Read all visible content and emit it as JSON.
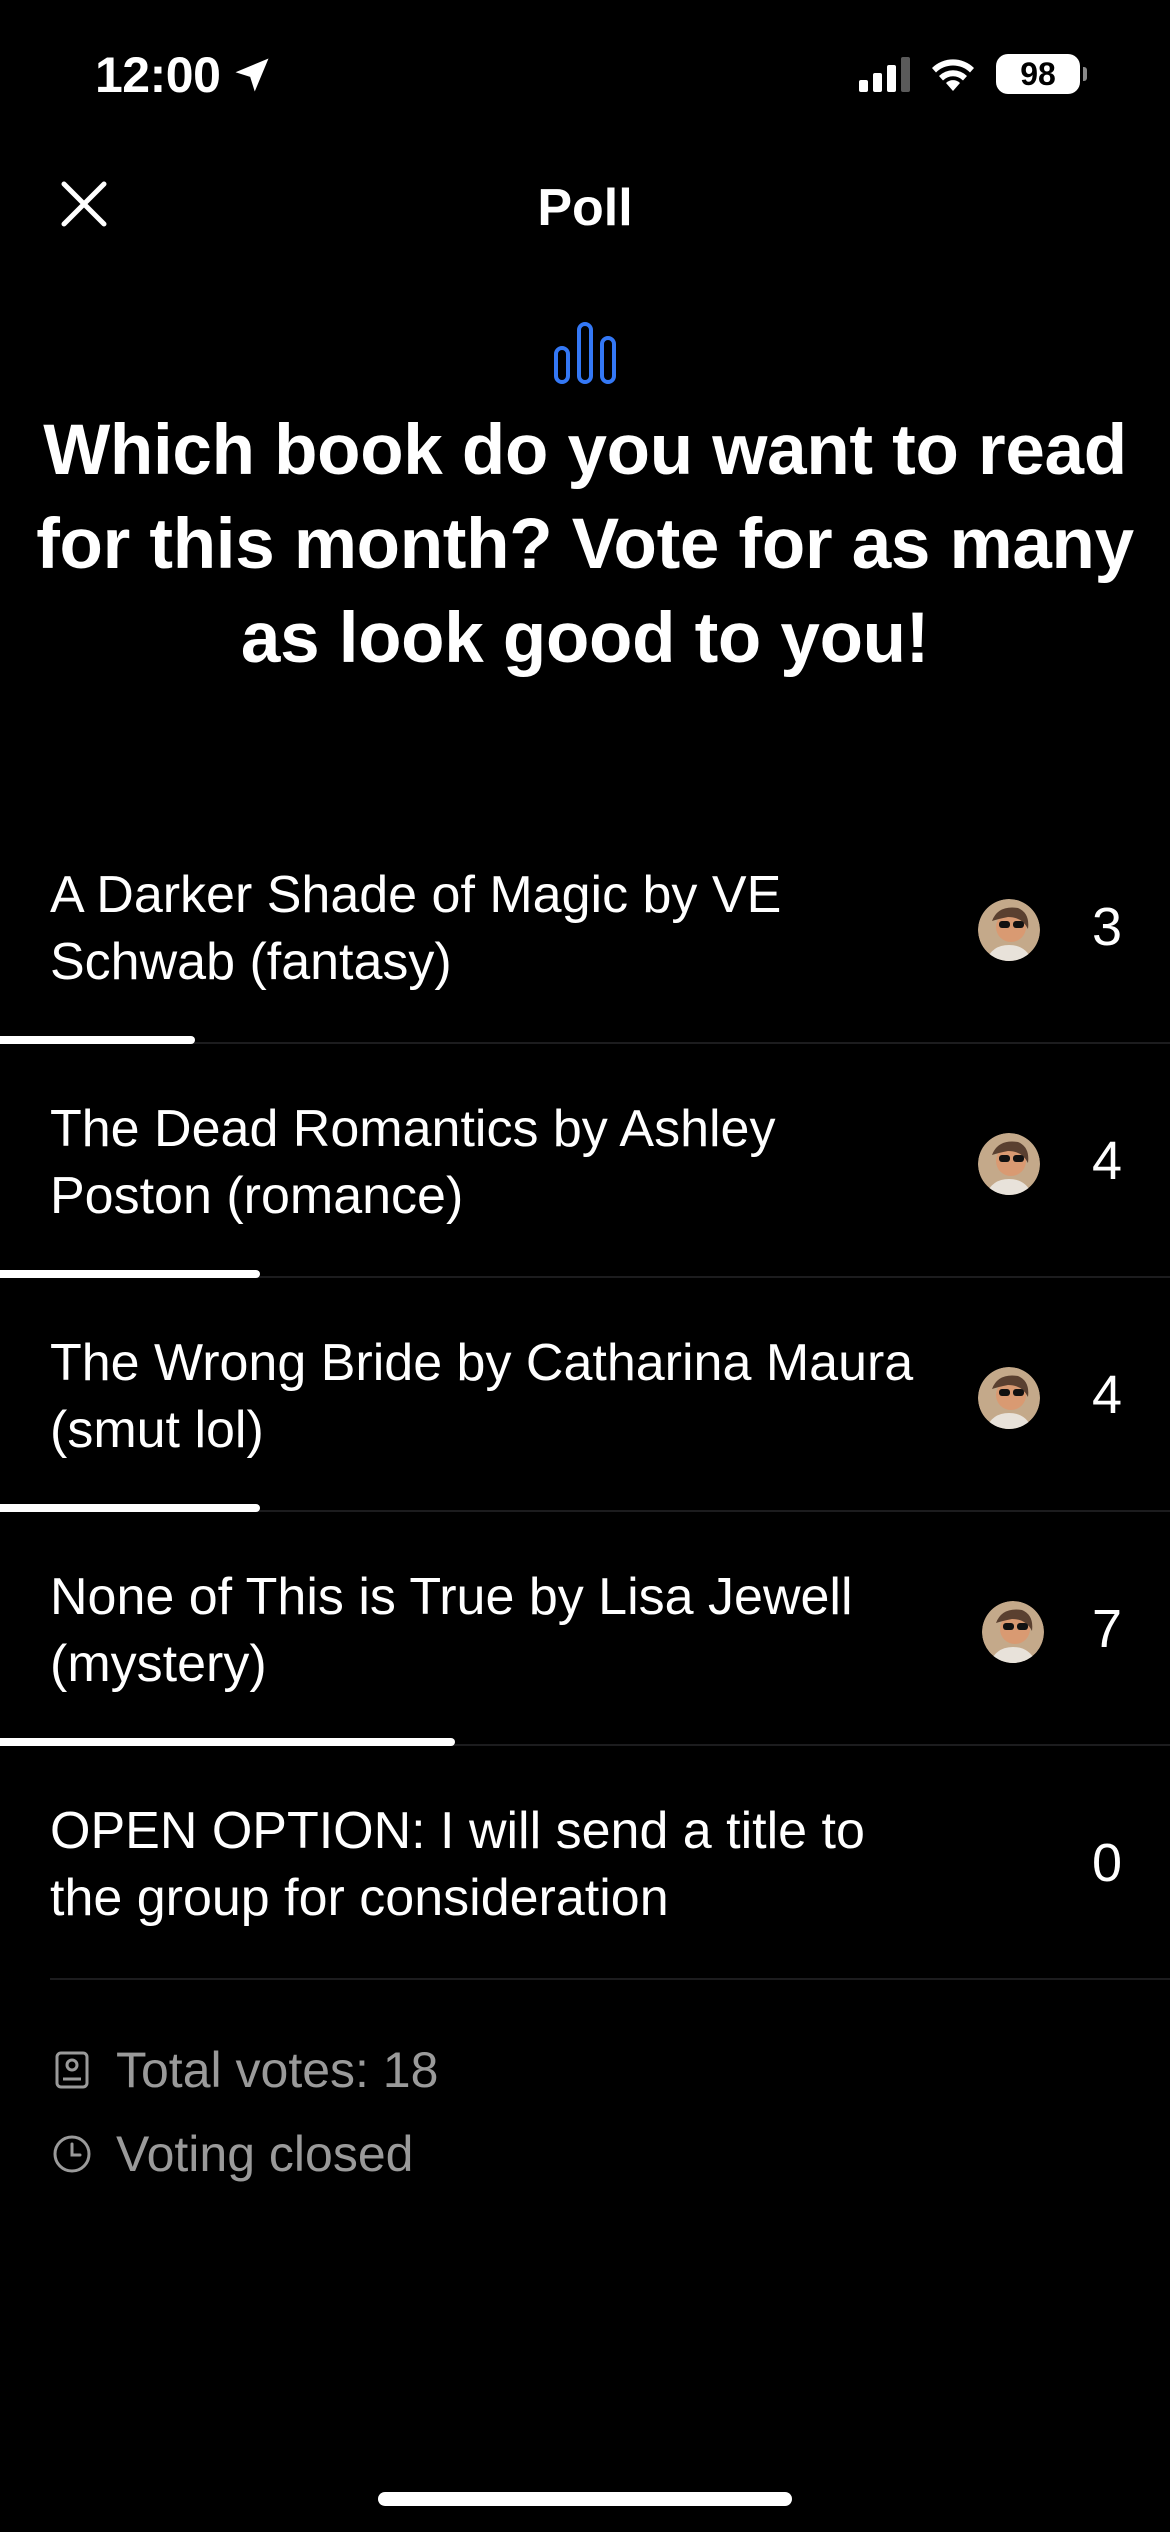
{
  "status_bar": {
    "time": "12:00",
    "battery": "98"
  },
  "header": {
    "title": "Poll"
  },
  "poll": {
    "question": "Which book do you want to read for this month? Vote for as many as look good to you!",
    "options": [
      {
        "text": "A Darker Shade of Magic by VE Schwab (fantasy)",
        "votes": "3",
        "share": 0.1667,
        "has_avatar": true
      },
      {
        "text": "The Dead Romantics by Ashley Poston (romance)",
        "votes": "4",
        "share": 0.2222,
        "has_avatar": true
      },
      {
        "text": "The Wrong Bride by Catharina Maura (smut lol)",
        "votes": "4",
        "share": 0.2222,
        "has_avatar": true
      },
      {
        "text": "None of This is True by Lisa Jewell (mystery)",
        "votes": "7",
        "share": 0.3889,
        "has_avatar": true
      },
      {
        "text": "OPEN OPTION: I will send a title to the group for consideration",
        "votes": "0",
        "share": 0,
        "has_avatar": false
      }
    ],
    "total_votes": "Total votes: 18",
    "status": "Voting closed"
  },
  "colors": {
    "background": "#000000",
    "accent": "#3478F6",
    "text": "#FFFFFF",
    "secondary_text": "#9A9A9A"
  }
}
